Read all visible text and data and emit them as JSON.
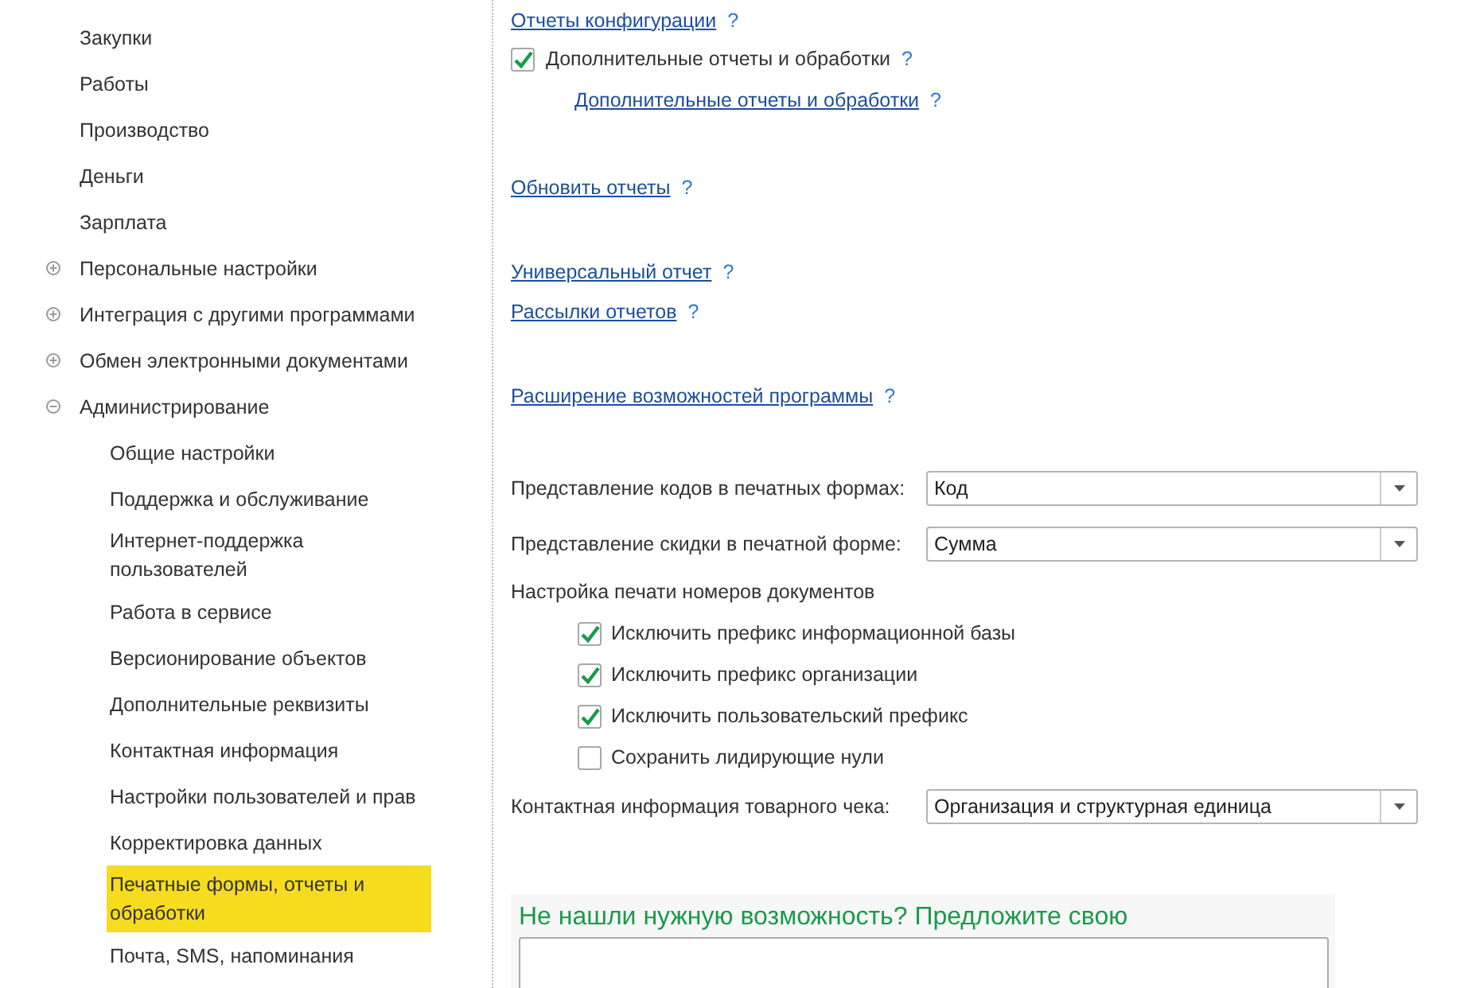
{
  "sidebar": {
    "items": [
      {
        "kind": "item",
        "label": "Закупки",
        "selected": false
      },
      {
        "kind": "item",
        "label": "Работы",
        "selected": false
      },
      {
        "kind": "item",
        "label": "Производство",
        "selected": false
      },
      {
        "kind": "item",
        "label": "Деньги",
        "selected": false
      },
      {
        "kind": "item",
        "label": "Зарплата",
        "selected": false
      },
      {
        "kind": "group",
        "label": "Персональные настройки",
        "expanded": false,
        "selected": false
      },
      {
        "kind": "group",
        "label": "Интеграция с другими программами",
        "expanded": false,
        "selected": false
      },
      {
        "kind": "group",
        "label": "Обмен электронными документами",
        "expanded": false,
        "selected": false
      },
      {
        "kind": "group",
        "label": "Администрирование",
        "expanded": true,
        "selected": false,
        "children": [
          {
            "label": "Общие настройки",
            "selected": false
          },
          {
            "label": "Поддержка и обслуживание",
            "selected": false
          },
          {
            "label": "Интернет-поддержка пользователей",
            "selected": false
          },
          {
            "label": "Работа в сервисе",
            "selected": false
          },
          {
            "label": "Версионирование объектов",
            "selected": false
          },
          {
            "label": "Дополнительные реквизиты",
            "selected": false
          },
          {
            "label": "Контактная информация",
            "selected": false
          },
          {
            "label": "Настройки пользователей и прав",
            "selected": false
          },
          {
            "label": "Корректировка данных",
            "selected": false
          },
          {
            "label": "Печатные формы, отчеты и обработки",
            "selected": true
          },
          {
            "label": "Почта, SMS, напоминания",
            "selected": false
          }
        ]
      }
    ]
  },
  "link_groups": [
    [
      {
        "kind": "link",
        "label": "Отчеты конфигурации",
        "help": "?"
      },
      {
        "kind": "checkbox",
        "label": "Дополнительные отчеты и обработки",
        "checked": true,
        "help": "?"
      },
      {
        "kind": "sublink",
        "label": "Дополнительные отчеты и обработки",
        "help": "?"
      }
    ],
    [
      {
        "kind": "link",
        "label": "Обновить отчеты",
        "help": "?"
      }
    ],
    [
      {
        "kind": "link",
        "label": "Универсальный отчет",
        "help": "?"
      },
      {
        "kind": "link",
        "label": "Рассылки отчетов",
        "help": "?"
      }
    ],
    [
      {
        "kind": "link",
        "label": "Расширение возможностей программы",
        "help": "?"
      }
    ]
  ],
  "settings": [
    {
      "kind": "select",
      "label": "Представление кодов в печатных формах:",
      "value": "Код"
    },
    {
      "kind": "select",
      "label": "Представление скидки в печатной форме:",
      "value": "Сумма"
    },
    {
      "kind": "heading",
      "label": "Настройка печати номеров документов"
    },
    {
      "kind": "checkbox",
      "label": "Исключить префикс информационной базы",
      "checked": true
    },
    {
      "kind": "checkbox",
      "label": "Исключить префикс организации",
      "checked": true
    },
    {
      "kind": "checkbox",
      "label": "Исключить пользовательский префикс",
      "checked": true
    },
    {
      "kind": "checkbox",
      "label": "Сохранить лидирующие нули",
      "checked": false
    },
    {
      "kind": "select",
      "label": "Контактная информация товарного чека:",
      "value": "Организация и структурная единица"
    }
  ],
  "suggestion": {
    "title": "Не нашли нужную возможность? Предложите свою"
  }
}
